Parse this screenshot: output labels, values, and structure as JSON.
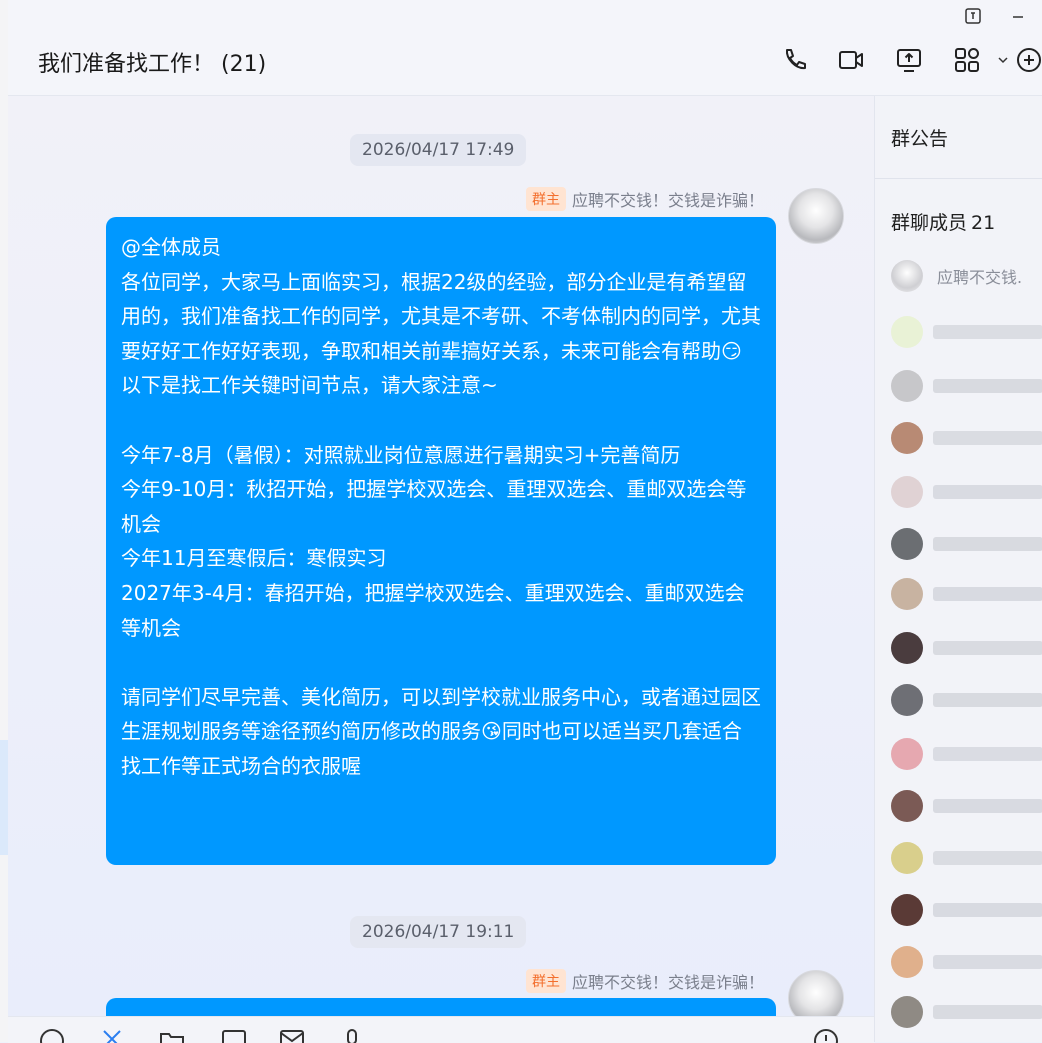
{
  "header": {
    "title": "我们准备找工作！ (21)"
  },
  "icons": {
    "phone": "phone-icon",
    "video": "video-camera-icon",
    "screen_share": "screen-share-icon",
    "apps": "apps-grid-icon",
    "add": "add-circle-icon"
  },
  "messages": [
    {
      "time": "2026/04/17 17:49",
      "badge": "群主",
      "sender": "应聘不交钱！交钱是诈骗！",
      "text": "@全体成员\n各位同学，大家马上面临实习，根据22级的经验，部分企业是有希望留用的，我们准备找工作的同学，尤其是不考研、不考体制内的同学，尤其要好好工作好好表现，争取和相关前辈搞好关系，未来可能会有帮助😏以下是找工作关键时间节点，请大家注意~\n\n今年7-8月（暑假）：对照就业岗位意愿进行暑期实习+完善简历\n今年9-10月：秋招开始，把握学校双选会、重理双选会、重邮双选会等机会\n今年11月至寒假后：寒假实习\n2027年3-4月：春招开始，把握学校双选会、重理双选会、重邮双选会等机会\n\n请同学们尽早完善、美化简历，可以到学校就业服务中心，或者通过园区生涯规划服务等途径预约简历修改的服务😘同时也可以适当买几套适合找工作等正式场合的衣服喔"
    },
    {
      "time": "2026/04/17 19:11",
      "badge": "群主",
      "sender": "应聘不交钱！交钱是诈骗！",
      "text": ""
    }
  ],
  "right_panel": {
    "announcement": "群公告",
    "members_title": "群聊成员",
    "members_count": "21",
    "first_member": "应聘不交钱."
  },
  "colors": {
    "bubble": "#0098ff",
    "badge_bg": "#ffe4d2",
    "badge_text": "#f36f2d"
  }
}
